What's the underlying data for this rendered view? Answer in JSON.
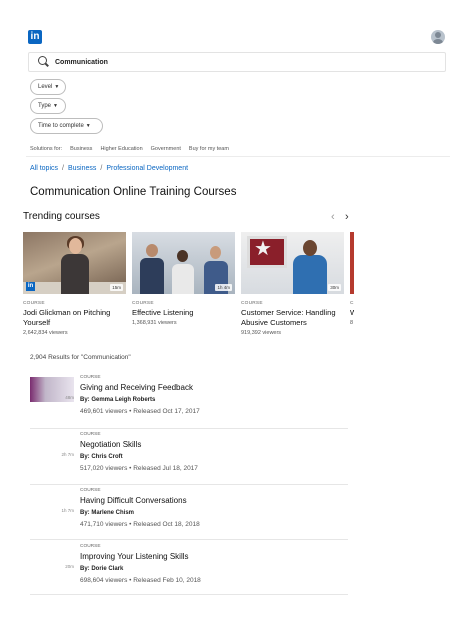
{
  "header": {
    "logo_text": "in"
  },
  "search": {
    "value": "Communication"
  },
  "filters": [
    {
      "label": "Level"
    },
    {
      "label": "Type"
    },
    {
      "label": "Time to complete"
    }
  ],
  "solutions": {
    "label": "Solutions for:",
    "items": [
      "Business",
      "Higher Education",
      "Government",
      "Buy for my team"
    ]
  },
  "breadcrumb": [
    "All topics",
    "Business",
    "Professional Development"
  ],
  "page_title": "Communication Online Training Courses",
  "trending": {
    "title": "Trending courses",
    "prev_arrow": "‹",
    "next_arrow": "›",
    "cards": [
      {
        "type": "COURSE",
        "title": "Jodi Glickman on Pitching Yourself",
        "viewers": "2,642,834 viewers",
        "duration": "15m"
      },
      {
        "type": "COURSE",
        "title": "Effective Listening",
        "viewers": "1,368,931 viewers",
        "duration": "1h 4m"
      },
      {
        "type": "COURSE",
        "title": "Customer Service: Handling Abusive Customers",
        "viewers": "919,392 viewers",
        "duration": "30m"
      },
      {
        "type": "C",
        "title": "W P",
        "viewers": "8",
        "duration": ""
      }
    ]
  },
  "results": {
    "count_text": "2,904 Results for \"Communication\"",
    "items": [
      {
        "type": "COURSE",
        "title": "Giving and Receiving Feedback",
        "author": "By: Gemma Leigh Roberts",
        "meta": "469,601 viewers • Released Oct 17, 2017",
        "duration": "48m"
      },
      {
        "type": "COURSE",
        "title": "Negotiation Skills",
        "author": "By: Chris Croft",
        "meta": "517,020 viewers • Released Jul 18, 2017",
        "duration": "2h 7m"
      },
      {
        "type": "COURSE",
        "title": "Having Difficult Conversations",
        "author": "By: Marlene Chism",
        "meta": "471,710 viewers • Released Oct 18, 2018",
        "duration": "1h 7m"
      },
      {
        "type": "COURSE",
        "title": "Improving Your Listening Skills",
        "author": "By: Dorie Clark",
        "meta": "698,604 viewers • Released Feb 10, 2018",
        "duration": "20m"
      }
    ]
  }
}
